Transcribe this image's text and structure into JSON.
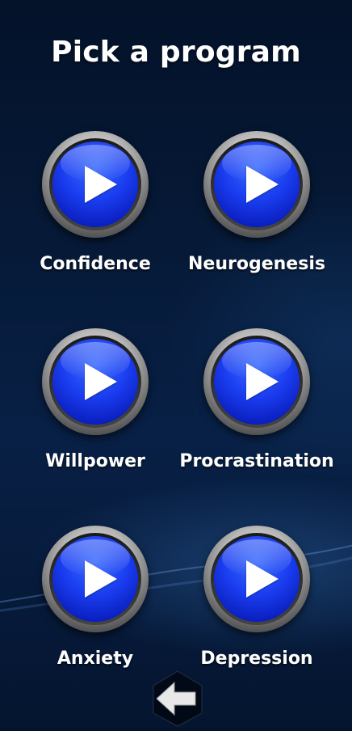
{
  "page": {
    "title": "Pick a program"
  },
  "programs": [
    {
      "label": "Confidence",
      "icon": "play-icon"
    },
    {
      "label": "Neurogenesis",
      "icon": "play-icon"
    },
    {
      "label": "Willpower",
      "icon": "play-icon"
    },
    {
      "label": "Procrastination",
      "icon": "play-icon"
    },
    {
      "label": "Anxiety",
      "icon": "play-icon"
    },
    {
      "label": "Depression",
      "icon": "play-icon"
    }
  ],
  "navigation": {
    "back_icon": "back-arrow-icon"
  },
  "colors": {
    "background": "#061a38",
    "button_blue": "#1a3df0",
    "text": "#ffffff"
  }
}
